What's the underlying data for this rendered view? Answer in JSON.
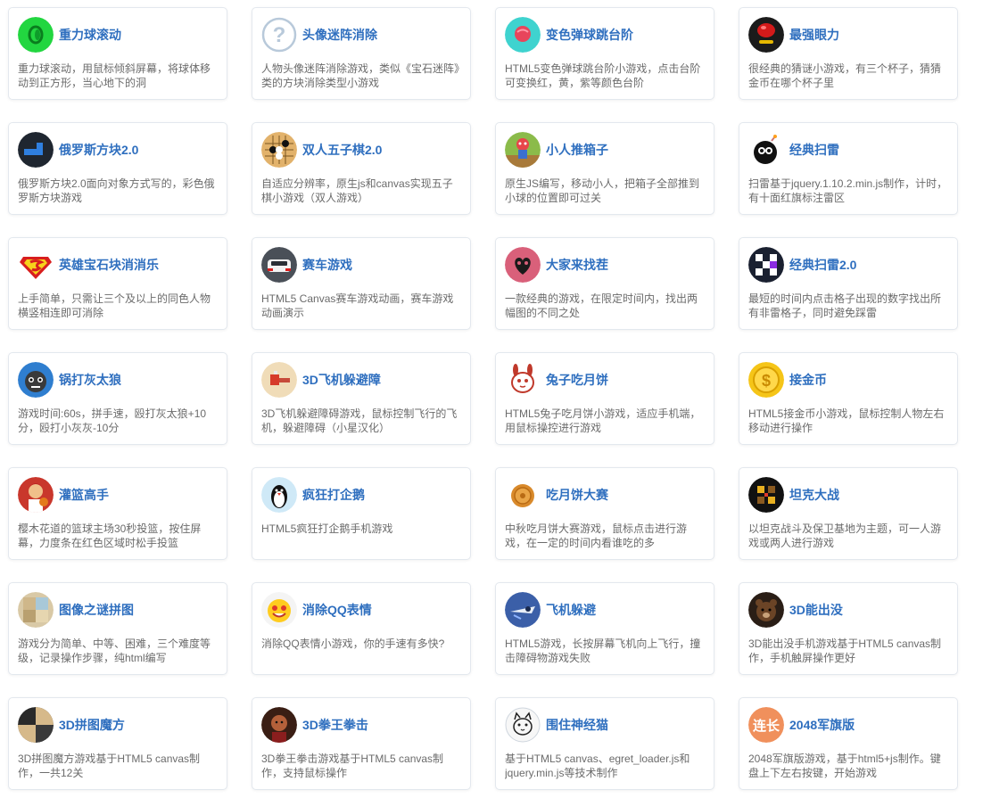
{
  "games": [
    {
      "title": "重力球滚动",
      "desc": "重力球滚动，用鼠标倾斜屏幕，将球体移动到正方形，当心地下的洞",
      "icon": "green-ball-icon"
    },
    {
      "title": "头像迷阵消除",
      "desc": "人物头像迷阵消除游戏，类似《宝石迷阵》类的方块消除类型小游戏",
      "icon": "question-mark-icon"
    },
    {
      "title": "变色弹球跳台阶",
      "desc": "HTML5变色弹球跳台阶小游戏，点击台阶可变换红，黄，紫等颜色台阶",
      "icon": "bounce-ball-icon"
    },
    {
      "title": "最强眼力",
      "desc": "很经典的猜谜小游戏，有三个杯子，猜猜金币在哪个杯子里",
      "icon": "cup-icon"
    },
    {
      "title": "俄罗斯方块2.0",
      "desc": "俄罗斯方块2.0面向对象方式写的，彩色俄罗斯方块游戏",
      "icon": "tetris-icon"
    },
    {
      "title": "双人五子棋2.0",
      "desc": "自适应分辨率，原生js和canvas实现五子棋小游戏（双人游戏）",
      "icon": "gomoku-icon"
    },
    {
      "title": "小人推箱子",
      "desc": "原生JS编写，移动小人，把箱子全部推到小球的位置即可过关",
      "icon": "sokoban-icon"
    },
    {
      "title": "经典扫雷",
      "desc": "扫雷基于jquery.1.10.2.min.js制作，计时，有十面红旗标注雷区",
      "icon": "bomb-icon"
    },
    {
      "title": "英雄宝石块消消乐",
      "desc": "上手简单，只需让三个及以上的同色人物横竖相连即可消除",
      "icon": "superman-icon"
    },
    {
      "title": "赛车游戏",
      "desc": "HTML5 Canvas赛车游戏动画，赛车游戏动画演示",
      "icon": "race-car-icon"
    },
    {
      "title": "大家来找茬",
      "desc": "一款经典的游戏，在限定时间内，找出两幅图的不同之处",
      "icon": "heart-icon"
    },
    {
      "title": "经典扫雷2.0",
      "desc": "最短的时间内点击格子出现的数字找出所有非雷格子，同时避免踩雷",
      "icon": "minesweeper-grid-icon"
    },
    {
      "title": "锅打灰太狼",
      "desc": "游戏时间:60s，拼手速，殴打灰太狼+10分，殴打小灰灰-10分",
      "icon": "wolf-icon"
    },
    {
      "title": "3D飞机躲避障",
      "desc": "3D飞机躲避障碍游戏，鼠标控制飞行的飞机，躲避障碍（小星汉化）",
      "icon": "plane-3d-icon"
    },
    {
      "title": "兔子吃月饼",
      "desc": "HTML5兔子吃月饼小游戏，适应手机端，用鼠标操控进行游戏",
      "icon": "rabbit-icon"
    },
    {
      "title": "接金币",
      "desc": "HTML5接金币小游戏，鼠标控制人物左右移动进行操作",
      "icon": "gold-coin-icon"
    },
    {
      "title": "灌篮高手",
      "desc": "樱木花道的篮球主场30秒投篮，按住屏幕，力度条在红色区域时松手投篮",
      "icon": "basketball-player-icon"
    },
    {
      "title": "疯狂打企鹅",
      "desc": "HTML5疯狂打企鹅手机游戏",
      "icon": "penguin-icon"
    },
    {
      "title": "吃月饼大赛",
      "desc": "中秋吃月饼大赛游戏，鼠标点击进行游戏，在一定的时间内看谁吃的多",
      "icon": "mooncake-icon"
    },
    {
      "title": "坦克大战",
      "desc": "以坦克战斗及保卫基地为主题，可一人游戏或两人进行游戏",
      "icon": "tank-icon"
    },
    {
      "title": "图像之谜拼图",
      "desc": "游戏分为简单、中等、困难，三个难度等级，记录操作步骤，纯html编写",
      "icon": "puzzle-image-icon"
    },
    {
      "title": "消除QQ表情",
      "desc": "消除QQ表情小游戏，你的手速有多快?",
      "icon": "qq-emoji-icon"
    },
    {
      "title": "飞机躲避",
      "desc": "HTML5游戏，长按屏幕飞机向上飞行，撞击障碍物游戏失败",
      "icon": "plane-dodge-icon"
    },
    {
      "title": "3D能出没",
      "desc": "3D能出没手机游戏基于HTML5 canvas制作，手机触屏操作更好",
      "icon": "bear-icon"
    },
    {
      "title": "3D拼图魔方",
      "desc": "3D拼图魔方游戏基于HTML5 canvas制作，一共12关",
      "icon": "cube-puzzle-icon"
    },
    {
      "title": "3D拳王拳击",
      "desc": "3D拳王拳击游戏基于HTML5 canvas制作，支持鼠标操作",
      "icon": "boxer-icon"
    },
    {
      "title": "围住神经猫",
      "desc": "基于HTML5 canvas、egret_loader.js和jquery.min.js等技术制作",
      "icon": "cat-icon"
    },
    {
      "title": "2048军旗版",
      "desc": "2048军旗版游戏，基于html5+js制作。键盘上下左右按键，开始游戏",
      "icon": "badge-2048-icon",
      "badge_text": "连长"
    }
  ]
}
